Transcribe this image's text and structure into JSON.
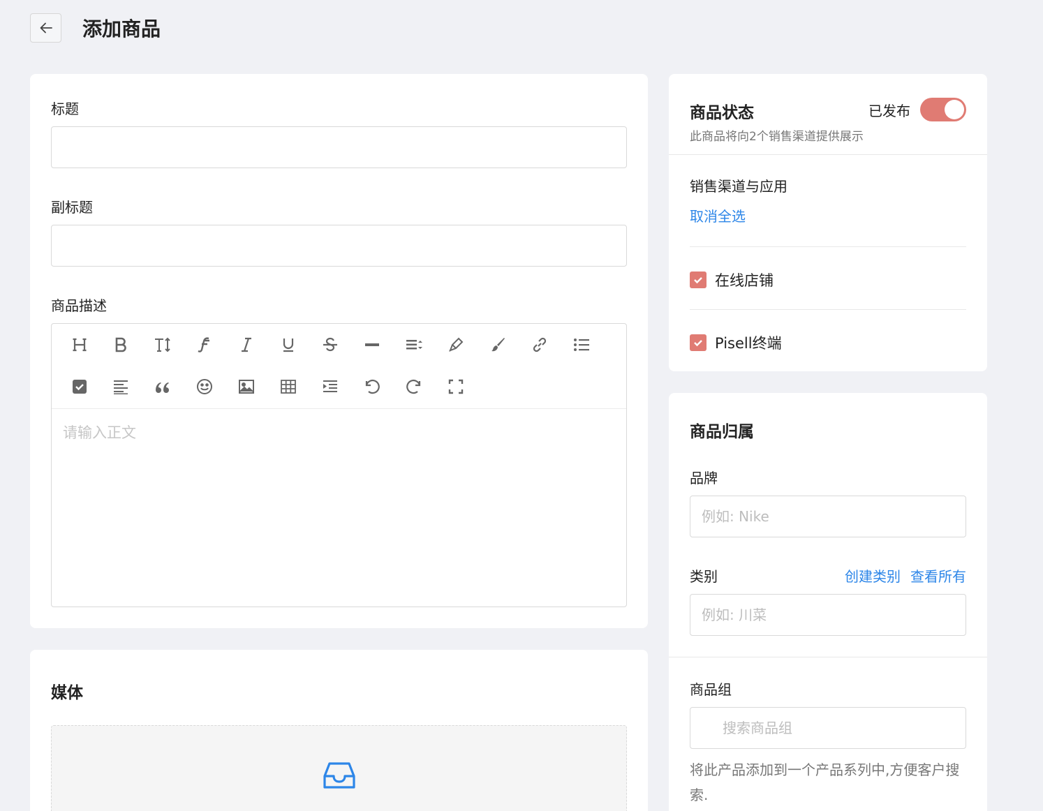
{
  "header": {
    "title": "添加商品"
  },
  "main": {
    "title_label": "标题",
    "subtitle_label": "副标题",
    "desc_label": "商品描述",
    "editor_placeholder": "请输入正文"
  },
  "toolbar_icons": [
    "heading-icon",
    "bold-icon",
    "font-size-icon",
    "font-family-icon",
    "italic-icon",
    "underline-icon",
    "strikethrough-icon",
    "horizontal-rule-icon",
    "line-height-icon",
    "highlight-pen-icon",
    "paint-brush-icon",
    "link-icon",
    "bullet-list-icon",
    "todo-checkbox-icon",
    "align-left-icon",
    "quote-icon",
    "emoji-icon",
    "image-icon",
    "table-icon",
    "indent-icon",
    "undo-icon",
    "redo-icon",
    "fullscreen-icon"
  ],
  "media": {
    "title": "媒体"
  },
  "status": {
    "title": "商品状态",
    "toggle_label": "已发布",
    "published": true,
    "subtitle": "此商品将向2个销售渠道提供展示",
    "channels_title": "销售渠道与应用",
    "deselect_all": "取消全选",
    "channels": [
      {
        "label": "在线店铺",
        "checked": true
      },
      {
        "label": "Pisell终端",
        "checked": true
      }
    ]
  },
  "org": {
    "title": "商品归属",
    "brand_label": "品牌",
    "brand_placeholder": "例如: Nike",
    "category_label": "类别",
    "create_category": "创建类别",
    "view_all": "查看所有",
    "category_placeholder": "例如: 川菜",
    "group_label": "商品组",
    "group_placeholder": "搜索商品组",
    "group_help": "将此产品添加到一个产品系列中,方便客户搜索."
  },
  "colors": {
    "accent": "#e07b73",
    "link": "#2d86e8",
    "background": "#f0f1f5"
  }
}
